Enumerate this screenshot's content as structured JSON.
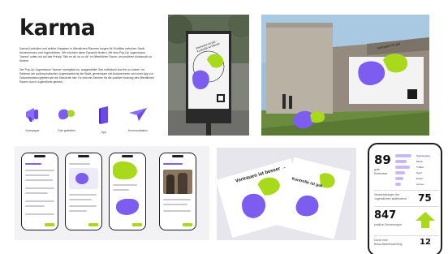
{
  "brand": {
    "wordmark": "karma",
    "paragraph_1": "Karma Kontrollen und striktor Vorgaben in öffentlichen Räumen sorgen für Konflikte zwischen Stadt, Anrainerinnen und Jugendlichen. Wir möchten diese Dynamik ändern. Mit dem Pop-Up Jugendraum \"karma\" sollen wir auf das Prinzip \"Wie es dir, so zu dir\" im öffentlichen Raum, um positiven Austausch zu fördern.",
    "paragraph_2": "Der Pop-Up Jugendraum \"karma\" ermöglicht es, ausgewählte Orte individuell und frei zu nutzen. Im Rahmen der außerschulischen Jugendarbeit ist die Stadt, gemeinsam mit Anrainerinnen und einer App zur Dokumentation geleitet wie die Standorte hier. Es wird ein Zeichen für die positive Nutzung des öffentlichen Raums durch Jugendliche gesetzt."
  },
  "icons": [
    {
      "icon": "megaphone-icon",
      "label": "Kampagne"
    },
    {
      "icon": "blob-shapes-icon",
      "label": "Orte gestalten"
    },
    {
      "icon": "phone-icon",
      "label": "App"
    },
    {
      "icon": "paper-plane-icon",
      "label": "Kommunikation"
    }
  ],
  "poster": {
    "ring_text": "Vertrauen ist gut · Kontrolle ist besser"
  },
  "photo": {
    "banner_text": "Vertrauen ist gut"
  },
  "print": {
    "line_1": "Vertrauen ist besser →",
    "line_2": "Kontrolle ist gut"
  },
  "dashboard": {
    "stat_1_value": "89",
    "stat_1_label": "gute Erlebnisse",
    "rows": [
      "Spaziergang",
      "Musik",
      "Treffen",
      "Sport",
      "Essen",
      "Lernen"
    ],
    "row_fills": [
      0.85,
      0.6,
      0.75,
      0.5,
      0.4,
      0.3
    ],
    "stat_2_label": "Veranstaltungen der Jugendlichen stattfindend",
    "stat_2_value": "75",
    "stat_3_value": "847",
    "stat_3_label": "positive Erinnerungen",
    "footer_label": "Durch eine Besuchsüberwachung",
    "footer_value": "12"
  },
  "colors": {
    "purple": "#7d5cf0",
    "lime": "#a8da1b",
    "ink": "#1b1b1b"
  }
}
